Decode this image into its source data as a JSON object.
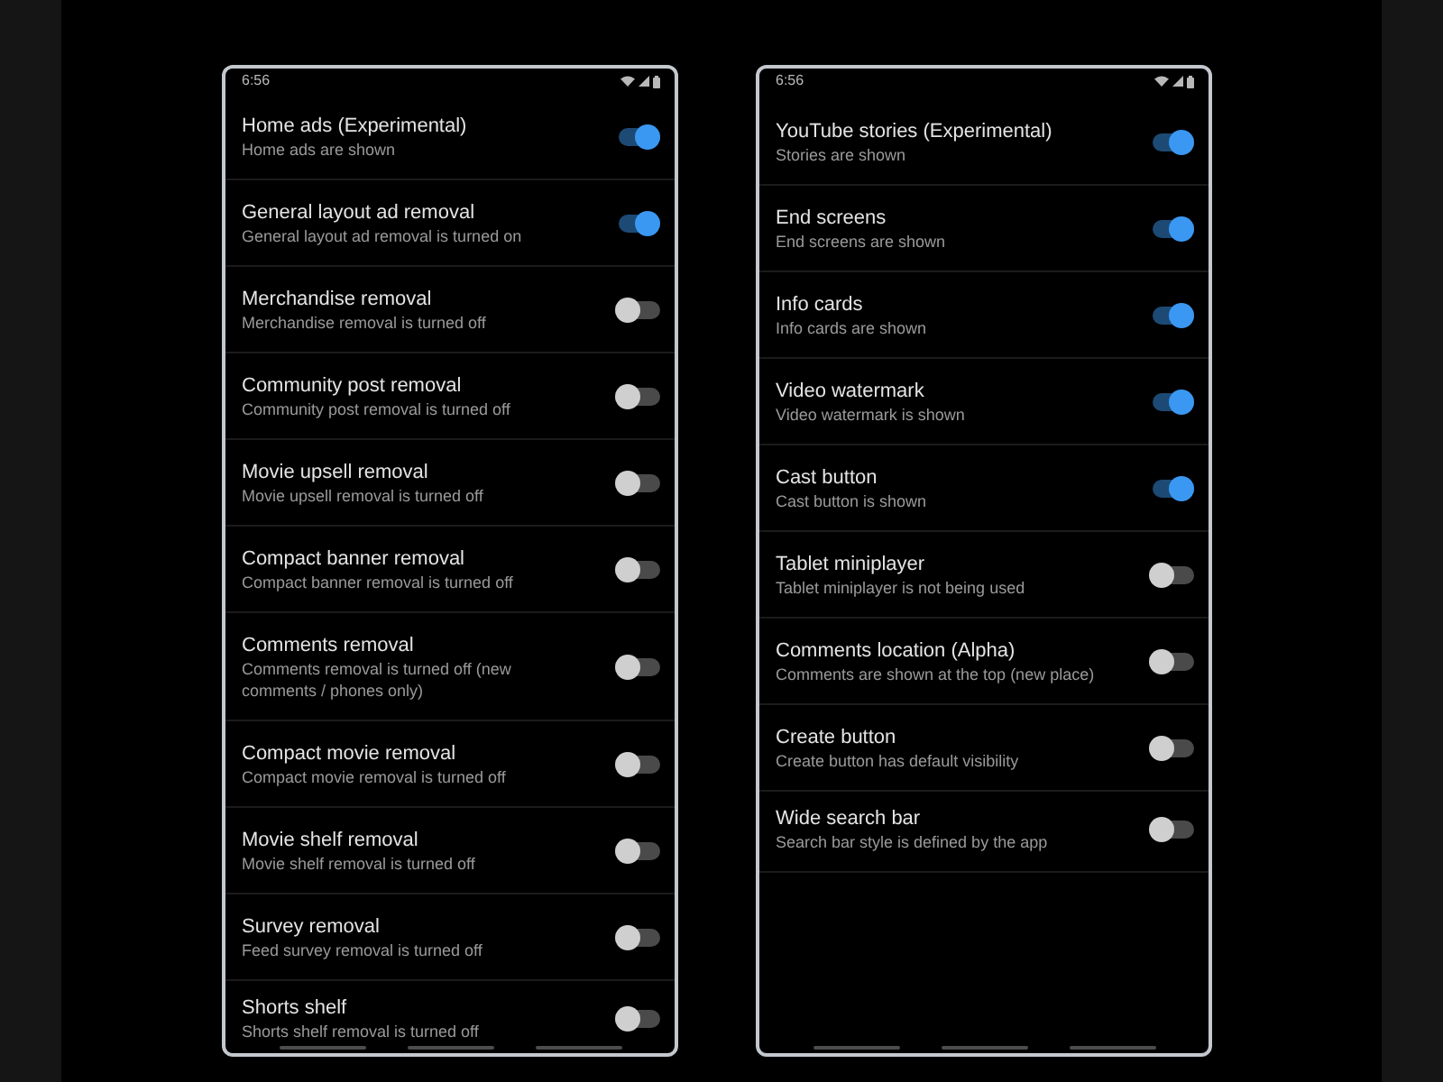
{
  "screens": [
    {
      "status_bar": {
        "time": "6:56"
      },
      "settings": [
        {
          "title": "Home ads (Experimental)",
          "summary": "Home ads are shown",
          "on": true
        },
        {
          "title": "General layout ad removal",
          "summary": "General layout ad removal is turned on",
          "on": true
        },
        {
          "title": "Merchandise removal",
          "summary": "Merchandise removal is turned off",
          "on": false
        },
        {
          "title": "Community post removal",
          "summary": "Community post removal is turned off",
          "on": false
        },
        {
          "title": "Movie upsell removal",
          "summary": "Movie upsell removal is turned off",
          "on": false
        },
        {
          "title": "Compact banner removal",
          "summary": "Compact banner removal is turned off",
          "on": false
        },
        {
          "title": "Comments removal",
          "summary": "Comments removal is turned off (new comments / phones only)",
          "on": false
        },
        {
          "title": "Compact movie removal",
          "summary": "Compact movie removal is turned off",
          "on": false
        },
        {
          "title": "Movie shelf removal",
          "summary": "Movie shelf removal is turned off",
          "on": false
        },
        {
          "title": "Survey removal",
          "summary": "Feed survey removal is turned off",
          "on": false
        },
        {
          "title": "Shorts shelf",
          "summary": "Shorts shelf removal is turned off",
          "on": false
        }
      ]
    },
    {
      "status_bar": {
        "time": "6:56"
      },
      "settings": [
        {
          "title": "YouTube stories (Experimental)",
          "summary": "Stories are shown",
          "on": true
        },
        {
          "title": "End screens",
          "summary": "End screens are shown",
          "on": true
        },
        {
          "title": "Info cards",
          "summary": "Info cards are shown",
          "on": true
        },
        {
          "title": "Video watermark",
          "summary": "Video watermark is shown",
          "on": true
        },
        {
          "title": "Cast button",
          "summary": "Cast button is shown",
          "on": true
        },
        {
          "title": "Tablet miniplayer",
          "summary": "Tablet miniplayer is not being used",
          "on": false
        },
        {
          "title": "Comments location (Alpha)",
          "summary": "Comments are shown at the top (new place)",
          "on": false
        },
        {
          "title": "Create button",
          "summary": "Create button has default visibility",
          "on": false
        },
        {
          "title": "Wide search bar",
          "summary": "Search bar style is defined by the app",
          "on": false
        }
      ]
    }
  ]
}
